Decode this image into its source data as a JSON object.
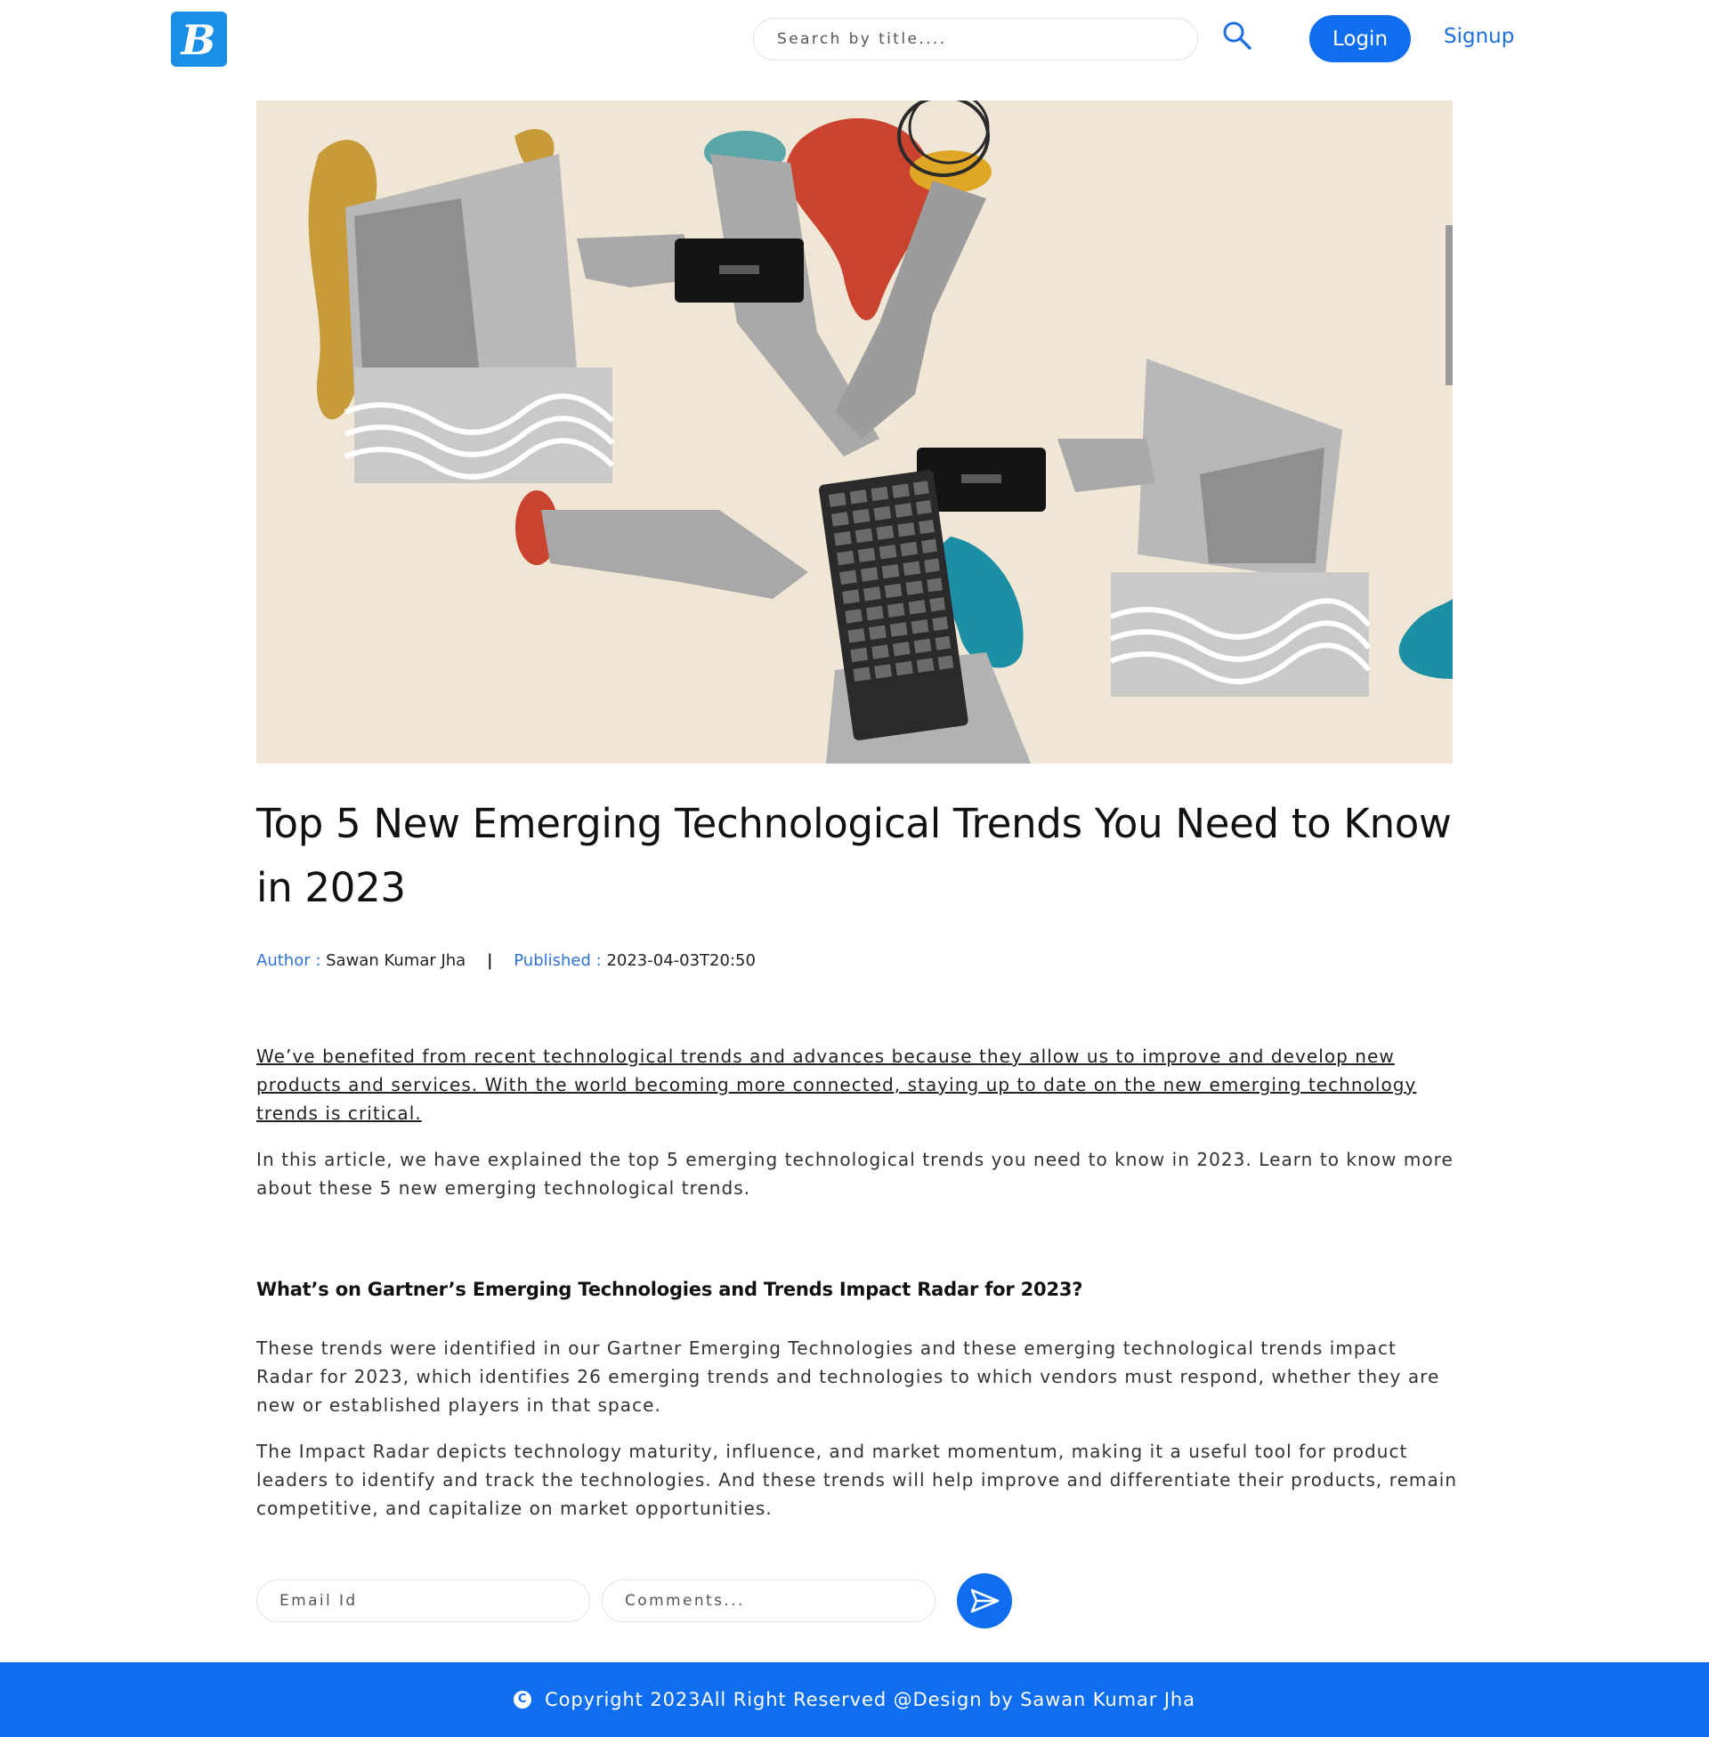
{
  "header": {
    "logo_icon": "blog-b-logo-icon",
    "search_placeholder": "Search by title....",
    "search_icon": "search-icon",
    "login_label": "Login",
    "signup_label": "Signup"
  },
  "hero": {
    "alt": "Collage of retro computers, hands, phones and a keyboard"
  },
  "article": {
    "title": "Top 5 New Emerging Technological Trends You Need to Know in 2023",
    "author_label": "Author :",
    "author": "Sawan Kumar Jha",
    "separator": "|",
    "published_label": "Published :",
    "published": "2023-04-03T20:50",
    "intro": "We’ve benefited from recent technological trends and advances because they allow us to improve and develop new products and services. With the world becoming more connected, staying up to date on the new emerging technology trends is critical.",
    "paragraph2": "In this article, we have explained the top 5 emerging technological trends you need to know in 2023. Learn to know more about these 5 new emerging technological trends.",
    "subheading": "What’s on Gartner’s Emerging Technologies and Trends Impact Radar for 2023?",
    "paragraph3": "These trends were identified in our Gartner Emerging Technologies and these emerging technological trends impact Radar for 2023, which identifies 26 emerging trends and technologies to which vendors must respond, whether they are new or established players in that space.",
    "paragraph4": "The Impact Radar depicts technology maturity, influence, and market momentum, making it a useful tool for product leaders to identify and track the technologies. And these trends will help improve and differentiate their products, remain competitive, and capitalize on market opportunities."
  },
  "comment_form": {
    "email_placeholder": "Email Id",
    "comments_placeholder": "Comments...",
    "send_icon": "send-icon"
  },
  "footer": {
    "copyright_symbol": "C",
    "text": "Copyright 2023All Right Reserved @Design by Sawan Kumar Jha"
  },
  "colors": {
    "accent": "#0f6ef0",
    "link": "#1e6fe0",
    "logo_bg": "#1a8fe6",
    "hero_bg": "#efe6d6"
  }
}
